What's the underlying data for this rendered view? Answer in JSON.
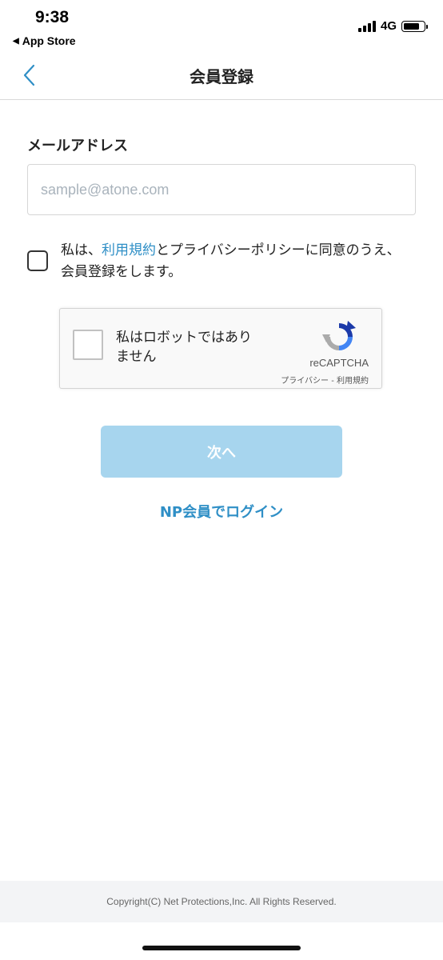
{
  "status_bar": {
    "time": "9:38",
    "back_app": "App Store",
    "network": "4G"
  },
  "nav": {
    "title": "会員登録",
    "back_icon": "chevron-left-icon",
    "accent_color": "#2f8fc6"
  },
  "form": {
    "email_label": "メールアドレス",
    "email_placeholder": "sample@atone.com",
    "email_value": "",
    "agree_prefix": "私は、",
    "agree_link": "利用規約",
    "agree_suffix": "とプライバシーポリシーに同意のうえ、会員登録をします。",
    "agree_checked": false
  },
  "recaptcha": {
    "label_line1": "私はロボットではあり",
    "label_line2": "ません",
    "brand": "reCAPTCHA",
    "links": "プライバシー - 利用規約"
  },
  "actions": {
    "next_label": "次へ",
    "np_login_label": "NP会員でログイン"
  },
  "footer": {
    "copyright": "Copyright(C) Net Protections,Inc. All Rights Reserved."
  }
}
